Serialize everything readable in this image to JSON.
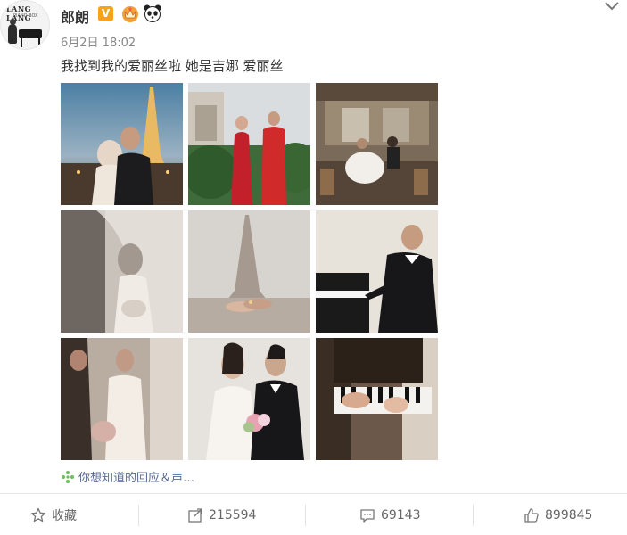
{
  "post": {
    "username": "郎朗",
    "verified_badge": "V",
    "timestamp": "6月2日 18:02",
    "text": "我找到我的爱丽丝啦 她是吉娜 爱丽丝",
    "related_link": "你想知道的回应＆声…"
  },
  "avatar": {
    "watermark": "LANG LANG",
    "subline": "PIANO BOX"
  },
  "actions": {
    "favorite_label": "收藏",
    "repost_count": "215594",
    "comment_count": "69143",
    "like_count": "899845"
  },
  "photos": [
    {
      "name": "eiffel-night-couple"
    },
    {
      "name": "red-qipao-arch"
    },
    {
      "name": "paris-cafe"
    },
    {
      "name": "bride-veil"
    },
    {
      "name": "eiffel-hands"
    },
    {
      "name": "groom-piano"
    },
    {
      "name": "couple-lace-dress"
    },
    {
      "name": "couple-bouquet"
    },
    {
      "name": "hands-on-keys"
    }
  ],
  "colors": {
    "link": "#576b95",
    "text": "#333333",
    "muted": "#888888",
    "verified": "#f7a21b"
  }
}
